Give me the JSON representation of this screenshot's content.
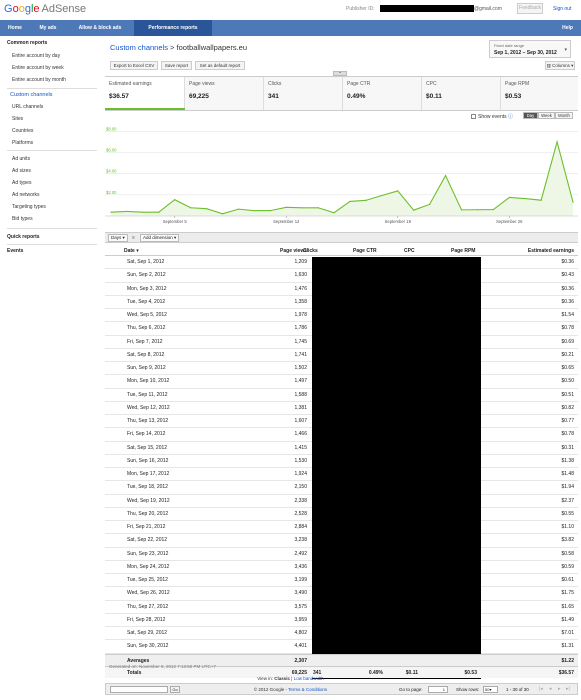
{
  "header": {
    "logo_google": [
      "G",
      "o",
      "o",
      "g",
      "l",
      "e"
    ],
    "logo_product": "AdSense",
    "publisher_label": "Publisher ID:",
    "email_suffix": "@gmail.com",
    "feedback_label": "Feedback",
    "signout_label": "Sign out"
  },
  "nav": {
    "tabs": [
      "Home",
      "My ads",
      "Allow & block ads",
      "Performance reports"
    ],
    "active": "Performance reports",
    "help_label": "Help"
  },
  "sidebar": {
    "common_reports_heading": "Common reports",
    "common_items": [
      "Entire account by day",
      "Entire account by week",
      "Entire account by month"
    ],
    "group1": [
      "Custom channels",
      "URL channels",
      "Sites",
      "Countries",
      "Platforms"
    ],
    "active_item": "Custom channels",
    "group2": [
      "Ad units",
      "Ad sizes",
      "Ad types",
      "Ad networks",
      "Targeting types",
      "Bid types"
    ],
    "quick_reports": "Quick reports",
    "events": "Events"
  },
  "report": {
    "breadcrumb_link": "Custom channels",
    "breadcrumb_sep": ">",
    "breadcrumb_current": "footballwallpapers.eu",
    "date_label": "Fixed date range",
    "date_value": "Sep 1, 2012 – Sep 30, 2012",
    "buttons": [
      "Export to Excel CSV",
      "Save report",
      "Set as default report"
    ],
    "columns_button": "Columns"
  },
  "metrics": [
    {
      "label": "Estimated earnings",
      "value": "$36.57"
    },
    {
      "label": "Page views",
      "value": "69,225"
    },
    {
      "label": "Clicks",
      "value": "341"
    },
    {
      "label": "Page CTR",
      "value": "0.49%"
    },
    {
      "label": "CPC",
      "value": "$0.11"
    },
    {
      "label": "Page RPM",
      "value": "$0.53"
    }
  ],
  "chart_controls": {
    "show_events": "Show events",
    "ranges": [
      "Day",
      "Week",
      "Month"
    ],
    "selected_range": "Day"
  },
  "chart_data": {
    "type": "area",
    "series": [
      {
        "values": [
          0.36,
          0.43,
          0.36,
          0.36,
          1.54,
          0.78,
          0.69,
          0.21,
          0.65,
          0.5,
          0.51,
          0.82,
          0.77,
          0.78,
          0.31,
          1.38,
          1.48,
          1.94,
          2.37,
          0.55,
          1.1,
          3.82,
          0.58,
          0.59,
          0.61,
          1.75,
          1.65,
          1.49,
          7.01,
          1.31
        ]
      }
    ],
    "y_ticks": [
      "$8.00",
      "$6.00",
      "$4.00",
      "$2.00"
    ],
    "ylim": [
      0,
      8.6
    ],
    "x_ticks": [
      "September 5",
      "September 12",
      "September 19",
      "September 26"
    ],
    "x_tick_days": [
      5,
      12,
      19,
      26
    ],
    "color": "#6cbf2c"
  },
  "table_toolbar": {
    "days_label": "Days",
    "sep": "≡",
    "add_dimension": "Add dimension"
  },
  "table": {
    "headers": [
      "Date",
      "Page views",
      "Clicks",
      "Page CTR",
      "CPC",
      "Page RPM",
      "Estimated earnings"
    ],
    "rows": [
      [
        "Sat, Sep 1, 2012",
        "1,209",
        "$0.36"
      ],
      [
        "Sun, Sep 2, 2012",
        "1,630",
        "$0.43"
      ],
      [
        "Mon, Sep 3, 2012",
        "1,476",
        "$0.36"
      ],
      [
        "Tue, Sep 4, 2012",
        "1,358",
        "$0.36"
      ],
      [
        "Wed, Sep 5, 2012",
        "1,978",
        "$1.54"
      ],
      [
        "Thu, Sep 6, 2012",
        "1,786",
        "$0.78"
      ],
      [
        "Fri, Sep 7, 2012",
        "1,745",
        "$0.69"
      ],
      [
        "Sat, Sep 8, 2012",
        "1,741",
        "$0.21"
      ],
      [
        "Sun, Sep 9, 2012",
        "1,502",
        "$0.65"
      ],
      [
        "Mon, Sep 10, 2012",
        "1,497",
        "$0.50"
      ],
      [
        "Tue, Sep 11, 2012",
        "1,588",
        "$0.51"
      ],
      [
        "Wed, Sep 12, 2012",
        "1,381",
        "$0.82"
      ],
      [
        "Thu, Sep 13, 2012",
        "1,607",
        "$0.77"
      ],
      [
        "Fri, Sep 14, 2012",
        "1,466",
        "$0.78"
      ],
      [
        "Sat, Sep 15, 2012",
        "1,415",
        "$0.31"
      ],
      [
        "Sun, Sep 16, 2012",
        "1,530",
        "$1.38"
      ],
      [
        "Mon, Sep 17, 2012",
        "1,924",
        "$1.48"
      ],
      [
        "Tue, Sep 18, 2012",
        "2,150",
        "$1.94"
      ],
      [
        "Wed, Sep 19, 2012",
        "2,338",
        "$2.37"
      ],
      [
        "Thu, Sep 20, 2012",
        "2,528",
        "$0.55"
      ],
      [
        "Fri, Sep 21, 2012",
        "2,884",
        "$1.10"
      ],
      [
        "Sat, Sep 22, 2012",
        "3,238",
        "$3.82"
      ],
      [
        "Sun, Sep 23, 2012",
        "2,492",
        "$0.58"
      ],
      [
        "Mon, Sep 24, 2012",
        "3,436",
        "$0.59"
      ],
      [
        "Tue, Sep 25, 2012",
        "3,199",
        "$0.61"
      ],
      [
        "Wed, Sep 26, 2012",
        "3,490",
        "$1.75"
      ],
      [
        "Thu, Sep 27, 2012",
        "3,575",
        "$1.65"
      ],
      [
        "Fri, Sep 28, 2012",
        "3,959",
        "$1.49"
      ],
      [
        "Sat, Sep 29, 2012",
        "4,802",
        "$7.01"
      ],
      [
        "Sun, Sep 30, 2012",
        "4,401",
        "$1.31"
      ]
    ],
    "averages": {
      "label": "Averages",
      "page_views": "2,307",
      "earnings": "$1.22"
    },
    "totals": {
      "label": "Totals",
      "page_views": "69,225",
      "clicks": "341",
      "ctr": "0.49%",
      "cpc": "$0.11",
      "rpm": "$0.53",
      "earnings": "$36.57"
    }
  },
  "pager": {
    "go_button": "Go",
    "goto_label": "Go to page:",
    "goto_value": "1",
    "rows_label": "Show rows:",
    "rows_value": "50",
    "range_text": "1 - 30 of 30"
  },
  "footer": {
    "generated": "Generated on: November 5, 2012 7:13:50 PM UTC+7",
    "view_in": "View in:",
    "classic": "Classic",
    "sep": "|",
    "low_bandwidth": "Low bandwidth",
    "copyright": "© 2012 Google -",
    "terms": "Terms & Conditions"
  }
}
